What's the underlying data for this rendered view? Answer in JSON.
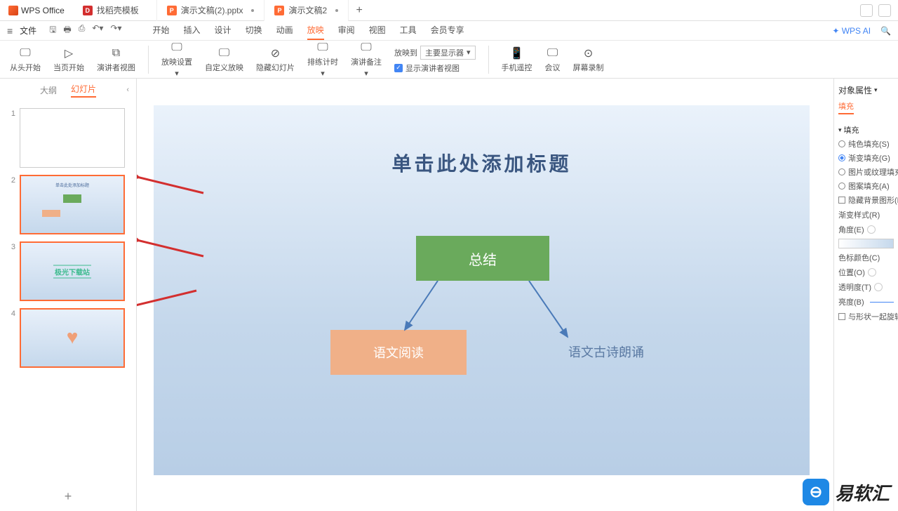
{
  "titlebar": {
    "brand": "WPS Office",
    "tabs": [
      {
        "label": "找稻壳模板"
      },
      {
        "label": "演示文稿(2).pptx"
      },
      {
        "label": "演示文稿2"
      }
    ]
  },
  "menubar": {
    "file": "文件",
    "tabs": [
      "开始",
      "插入",
      "设计",
      "切换",
      "动画",
      "放映",
      "审阅",
      "视图",
      "工具",
      "会员专享"
    ],
    "active_tab": "放映",
    "ai": "WPS AI"
  },
  "ribbon": {
    "from_start": "从头开始",
    "from_current": "当页开始",
    "presenter_view": "演讲者视图",
    "settings": "放映设置",
    "custom": "自定义放映",
    "hide_slide": "隐藏幻灯片",
    "rehearse": "排练计时",
    "notes": "演讲备注",
    "show_presenter_chk": "显示演讲者视图",
    "play_to_label": "放映到",
    "play_to_value": "主要显示器",
    "phone": "手机遥控",
    "meeting": "会议",
    "record": "屏幕录制"
  },
  "panel": {
    "outline": "大纲",
    "slides": "幻灯片",
    "thumb3_text": "极光下载站"
  },
  "canvas": {
    "title": "单击此处添加标题",
    "box_green": "总结",
    "box_peach": "语文阅读",
    "box_text": "语文古诗朗诵"
  },
  "props": {
    "title": "对象属性",
    "fill_tab": "填充",
    "fill_section": "填充",
    "solid": "纯色填充(S)",
    "gradient": "渐变填充(G)",
    "picture": "图片或纹理填充",
    "pattern": "图案填充(A)",
    "hide_bg": "隐藏背景图形(H)",
    "grad_style": "渐变样式(R)",
    "angle": "角度(E)",
    "stop_color": "色标颜色(C)",
    "position": "位置(O)",
    "transparency": "透明度(T)",
    "brightness": "亮度(B)",
    "rotate_with": "与形状一起旋转"
  },
  "watermark": "易软汇"
}
